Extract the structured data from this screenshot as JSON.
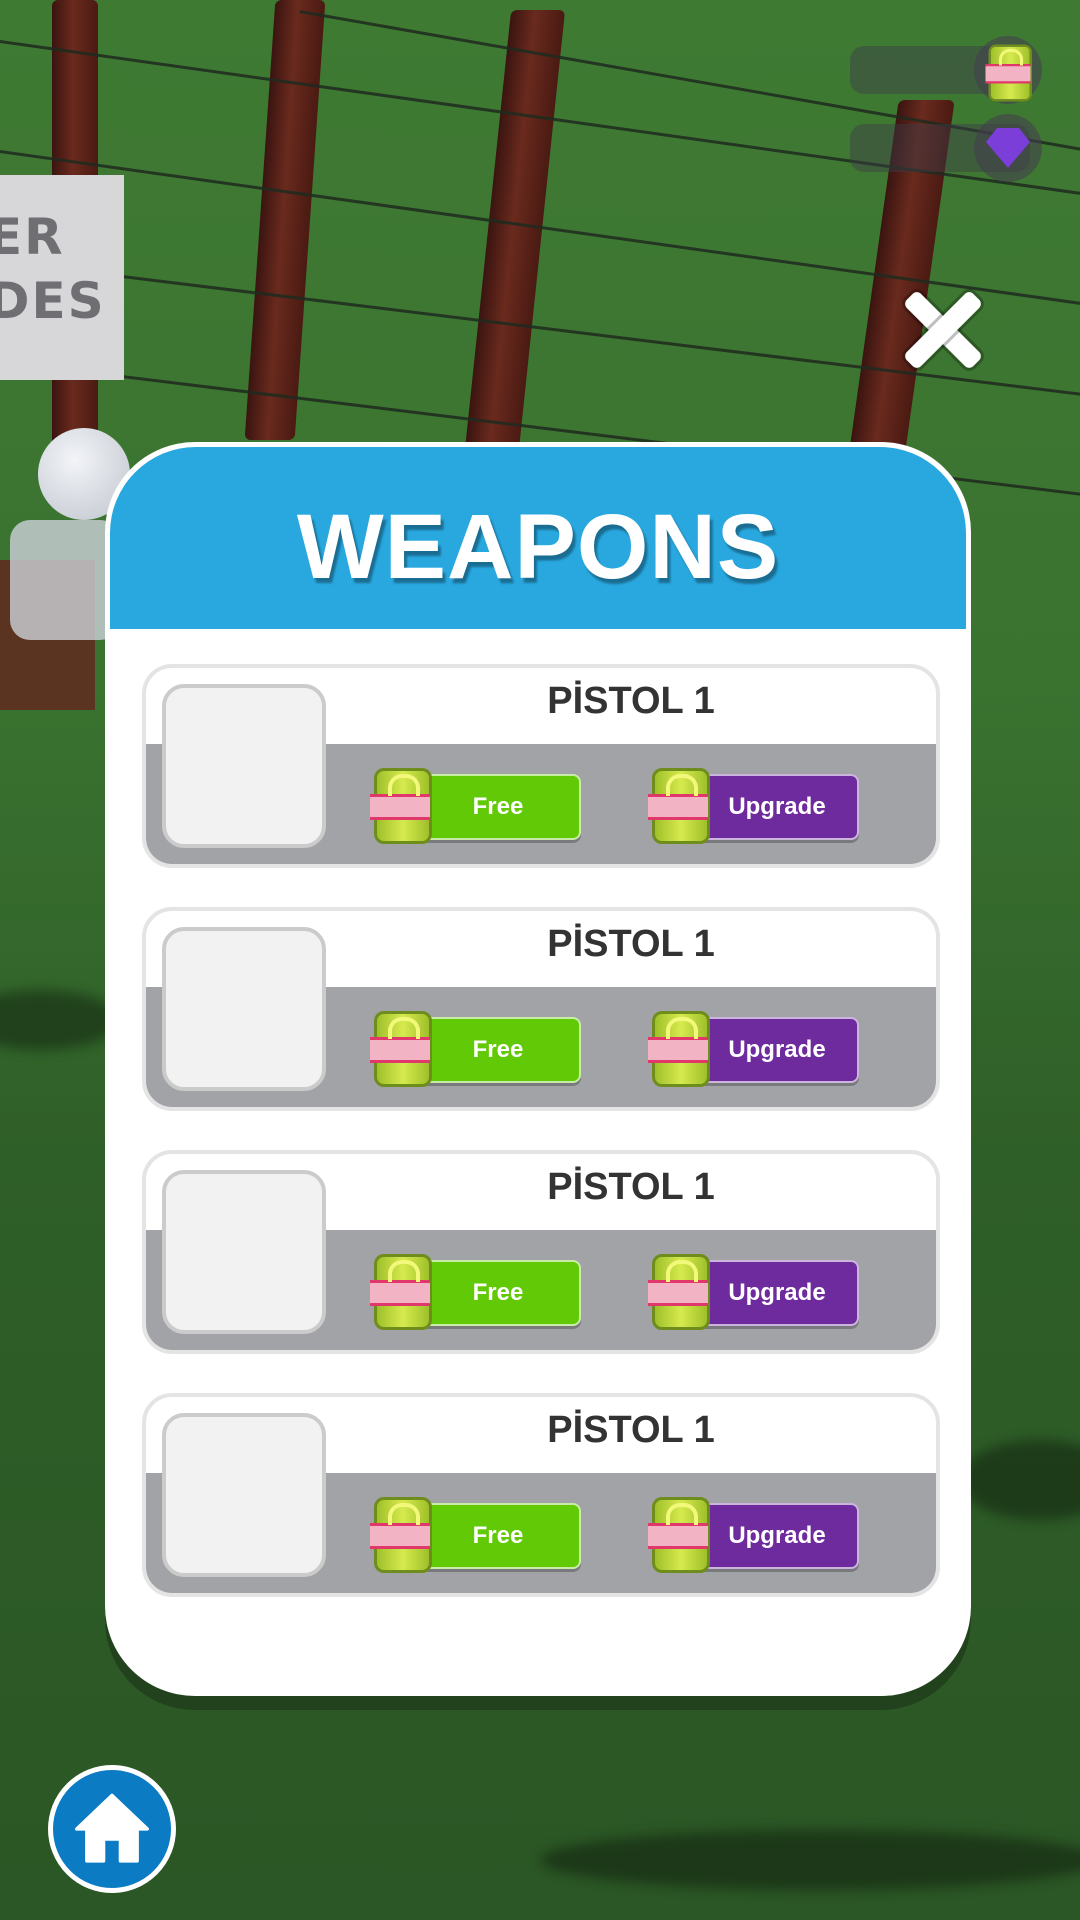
{
  "background_sign": {
    "line1": "ER",
    "line2": "DES"
  },
  "hud": {
    "cash_icon": "cash-stack-icon",
    "gem_icon": "gem-icon"
  },
  "close_icon": "close-icon",
  "panel": {
    "title": "WEAPONS",
    "items": [
      {
        "name": "PİSTOL 1",
        "free_label": "Free",
        "upgrade_label": "Upgrade"
      },
      {
        "name": "PİSTOL 1",
        "free_label": "Free",
        "upgrade_label": "Upgrade"
      },
      {
        "name": "PİSTOL 1",
        "free_label": "Free",
        "upgrade_label": "Upgrade"
      },
      {
        "name": "PİSTOL 1",
        "free_label": "Free",
        "upgrade_label": "Upgrade"
      }
    ]
  },
  "home_icon": "home-icon",
  "colors": {
    "header": "#29a8e0",
    "free_button": "#62c906",
    "upgrade_button": "#6e2b9e",
    "home_button": "#0b7bc4",
    "card_bottom": "#a2a3a7"
  }
}
